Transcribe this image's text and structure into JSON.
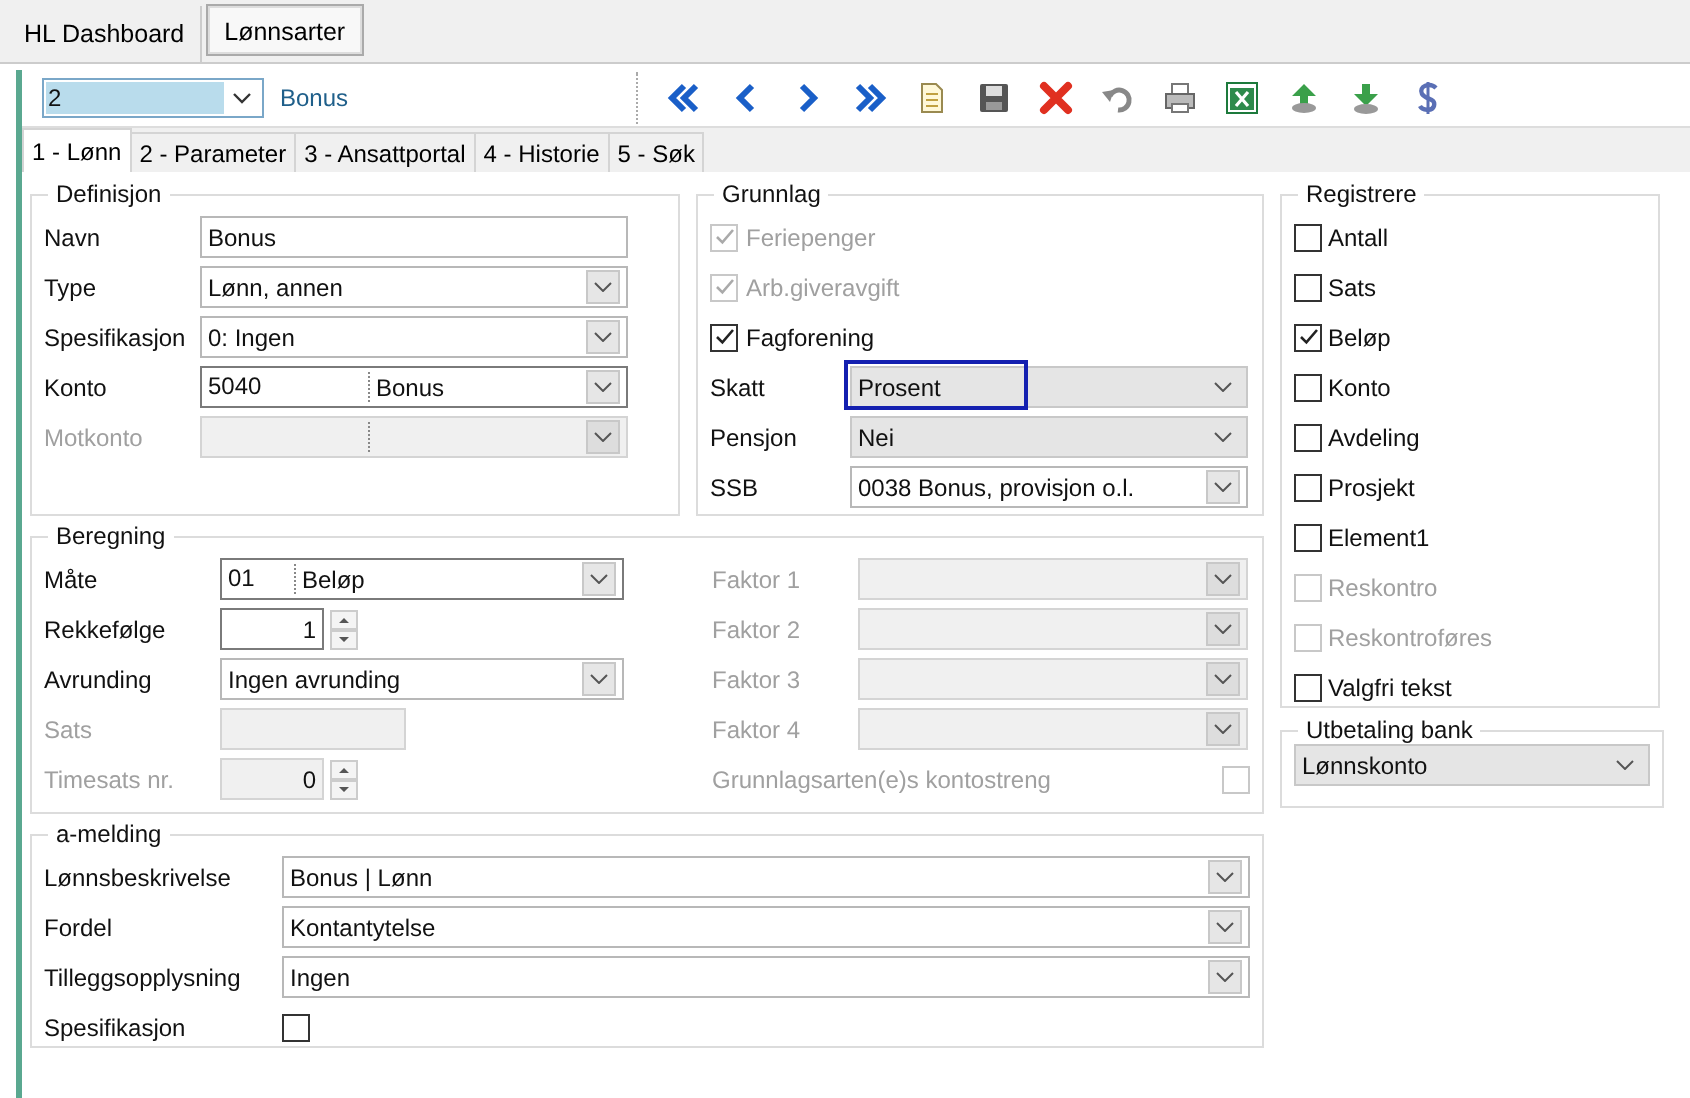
{
  "doc_tabs": [
    {
      "label": "HL Dashboard",
      "selected": false
    },
    {
      "label": "Lønnsarter",
      "selected": true
    }
  ],
  "toolbar": {
    "code": "2",
    "name": "Bonus"
  },
  "tabs": [
    {
      "label": "1 - Lønn",
      "selected": true
    },
    {
      "label": "2 - Parameter",
      "selected": false
    },
    {
      "label": "3 - Ansattportal",
      "selected": false
    },
    {
      "label": "4 - Historie",
      "selected": false
    },
    {
      "label": "5 - Søk",
      "selected": false
    }
  ],
  "definisjon": {
    "title": "Definisjon",
    "rows": [
      {
        "label": "Navn",
        "kind": "text",
        "value": "Bonus",
        "disabled": false
      },
      {
        "label": "Type",
        "kind": "select",
        "value": "Lønn, annen",
        "disabled": false
      },
      {
        "label": "Spesifikasjon",
        "kind": "select",
        "value": "0:  Ingen",
        "disabled": false
      },
      {
        "label": "Konto",
        "kind": "split",
        "code": "5040",
        "value": "Bonus",
        "disabled": false
      },
      {
        "label": "Motkonto",
        "kind": "split",
        "disabled": true
      }
    ]
  },
  "grunnlag": {
    "title": "Grunnlag",
    "checks": [
      {
        "label": "Feriepenger",
        "checked": true,
        "disabled": true
      },
      {
        "label": "Arb.giveravgift",
        "checked": true,
        "disabled": true
      },
      {
        "label": "Fagforening",
        "checked": true,
        "disabled": false
      }
    ],
    "rows": [
      {
        "label": "Skatt",
        "kind": "dropdown",
        "value": "Prosent",
        "focused": true
      },
      {
        "label": "Pensjon",
        "kind": "dropdown",
        "value": "Nei",
        "focused": false
      },
      {
        "label": "SSB",
        "kind": "select",
        "value": "0038 Bonus, provisjon o.l.",
        "focused": false
      }
    ]
  },
  "beregning": {
    "title": "Beregning",
    "left": [
      {
        "label": "Måte",
        "kind": "split",
        "code": "01",
        "value": "Beløp",
        "disabled": false
      },
      {
        "label": "Rekkefølge",
        "kind": "spin",
        "value": "1",
        "disabled": false
      },
      {
        "label": "Avrunding",
        "kind": "select",
        "value": "Ingen avrunding",
        "disabled": false
      },
      {
        "label": "Sats",
        "kind": "text",
        "disabled": true
      },
      {
        "label": "Timesats nr.",
        "kind": "spin",
        "value": "0",
        "disabled": true
      }
    ],
    "right": [
      {
        "label": "Faktor 1",
        "kind": "select",
        "disabled": true
      },
      {
        "label": "Faktor 2",
        "kind": "select",
        "disabled": true
      },
      {
        "label": "Faktor 3",
        "kind": "select",
        "disabled": true
      },
      {
        "label": "Faktor 4",
        "kind": "select",
        "disabled": true
      },
      {
        "label": "Grunnlagsarten(e)s kontostreng",
        "kind": "check",
        "checked": false,
        "disabled": true
      }
    ]
  },
  "a_melding": {
    "title": "a-melding",
    "rows": [
      {
        "label": "Lønnsbeskrivelse",
        "kind": "select",
        "value": "Bonus | Lønn"
      },
      {
        "label": "Fordel",
        "kind": "select",
        "value": "Kontantytelse"
      },
      {
        "label": "Tilleggsopplysning",
        "kind": "select",
        "value": "Ingen"
      },
      {
        "label": "Spesifikasjon",
        "kind": "check",
        "checked": false
      }
    ]
  },
  "registrere": {
    "title": "Registrere",
    "items": [
      {
        "label": "Antall",
        "checked": false,
        "disabled": false
      },
      {
        "label": "Sats",
        "checked": false,
        "disabled": false
      },
      {
        "label": "Beløp",
        "checked": true,
        "disabled": false
      },
      {
        "label": "Konto",
        "checked": false,
        "disabled": false
      },
      {
        "label": "Avdeling",
        "checked": false,
        "disabled": false
      },
      {
        "label": "Prosjekt",
        "checked": false,
        "disabled": false
      },
      {
        "label": "Element1",
        "checked": false,
        "disabled": false
      },
      {
        "label": "Reskontro",
        "checked": false,
        "disabled": true
      },
      {
        "label": "Reskontroføres",
        "checked": false,
        "disabled": true
      },
      {
        "label": "Valgfri tekst",
        "checked": false,
        "disabled": false
      }
    ]
  },
  "utbetaling": {
    "title": "Utbetaling bank",
    "value": "Lønnskonto"
  }
}
